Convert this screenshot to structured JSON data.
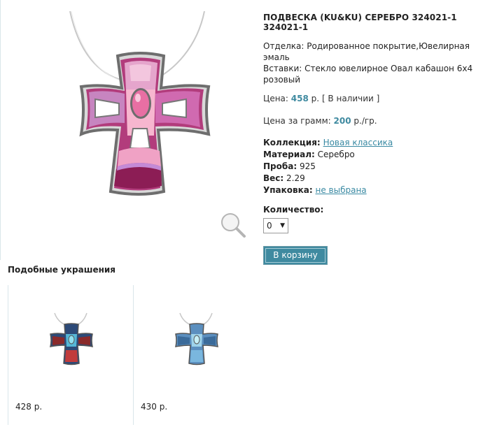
{
  "product": {
    "title": "ПОДВЕСКА (KU&KU) СЕРЕБРО 324021-1 324021-1",
    "finish_label": "Отделка:",
    "finish_value": "Родированное покрытие,Ювелирная эмаль",
    "inserts_label": "Вставки:",
    "inserts_value": "Стекло ювелирное Овал кабашон 6х4 розовый",
    "price_label": "Цена:",
    "price_value": "458",
    "price_unit": "р.",
    "availability": "[ В наличии ]",
    "gram_label": "Цена за грамм:",
    "gram_value": "200",
    "gram_unit": "р./гр.",
    "collection_label": "Коллекция:",
    "collection_value": "Новая классика",
    "material_label": "Материал:",
    "material_value": "Серебро",
    "assay_label": "Проба:",
    "assay_value": "925",
    "weight_label": "Вес:",
    "weight_value": "2.29",
    "package_label": "Упаковка:",
    "package_value": "не выбрана",
    "qty_label": "Количество:",
    "qty_value": "0",
    "cart_label": "В корзину"
  },
  "similar": {
    "title": "Подобные украшения",
    "items": [
      {
        "price": "428 р.",
        "scheme": "dark"
      },
      {
        "price": "430 р.",
        "scheme": "blue"
      }
    ]
  },
  "icons": {
    "zoom": "magnifier-icon",
    "dropdown": "chevron-down-icon"
  },
  "colors": {
    "accent": "#3f8aa0",
    "link": "#3a8aa3",
    "enamel_pink": "#f2a7c3",
    "enamel_magenta": "#a0205e",
    "enamel_lilac": "#c48ad6"
  }
}
